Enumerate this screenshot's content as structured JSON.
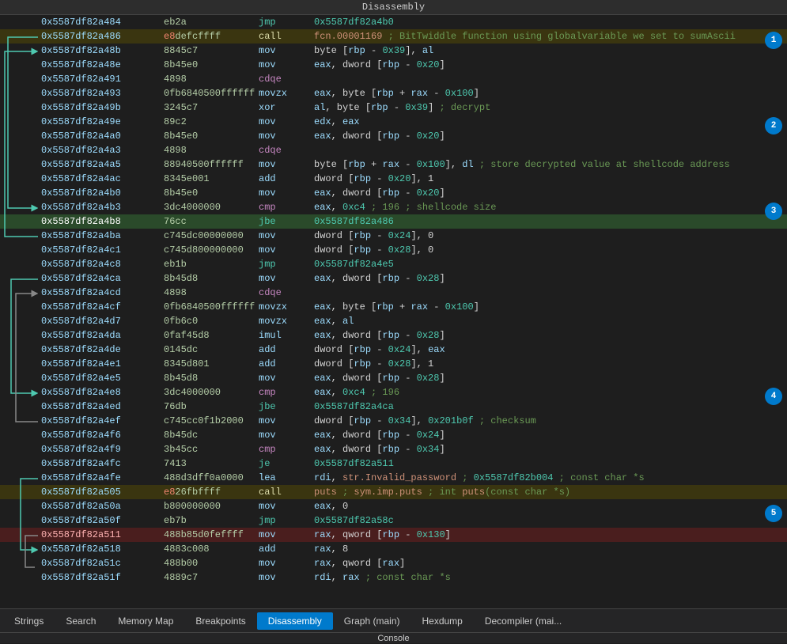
{
  "header": {
    "title": "Disassembly"
  },
  "badges": [
    "1",
    "2",
    "3",
    "4",
    "5"
  ],
  "rows": [
    {
      "addr": "0x5587df82a484",
      "bytes": "eb2a",
      "mnem": "jmp",
      "mnem_class": "jmp",
      "operands": "0x5587df82a4b0",
      "highlight": ""
    },
    {
      "addr": "0x5587df82a486",
      "bytes": "e8defcffff",
      "mnem": "call",
      "mnem_class": "call",
      "operands": "fcn.00001169 ; BitTwiddle function using globalvariable we set to sumAscii",
      "highlight": "call-bg"
    },
    {
      "addr": "0x5587df82a48b",
      "bytes": "8845c7",
      "mnem": "mov",
      "mnem_class": "mov",
      "operands": "byte [rbp - 0x39], al",
      "highlight": ""
    },
    {
      "addr": "0x5587df82a48e",
      "bytes": "8b45e0",
      "mnem": "mov",
      "mnem_class": "mov",
      "operands": "eax, dword [rbp - 0x20]",
      "highlight": ""
    },
    {
      "addr": "0x5587df82a491",
      "bytes": "4898",
      "mnem": "cdqe",
      "mnem_class": "cdqe",
      "operands": "",
      "highlight": ""
    },
    {
      "addr": "0x5587df82a493",
      "bytes": "0fb6840500ffffff",
      "mnem": "movzx",
      "mnem_class": "movzx",
      "operands": "eax, byte [rbp + rax - 0x100]",
      "highlight": ""
    },
    {
      "addr": "0x5587df82a49b",
      "bytes": "3245c7",
      "mnem": "xor",
      "mnem_class": "xor",
      "operands": "al, byte [rbp - 0x39] ; decrypt",
      "highlight": ""
    },
    {
      "addr": "0x5587df82a49e",
      "bytes": "89c2",
      "mnem": "mov",
      "mnem_class": "mov",
      "operands": "edx, eax",
      "highlight": ""
    },
    {
      "addr": "0x5587df82a4a0",
      "bytes": "8b45e0",
      "mnem": "mov",
      "mnem_class": "mov",
      "operands": "eax, dword [rbp - 0x20]",
      "highlight": ""
    },
    {
      "addr": "0x5587df82a4a3",
      "bytes": "4898",
      "mnem": "cdqe",
      "mnem_class": "cdqe",
      "operands": "",
      "highlight": ""
    },
    {
      "addr": "0x5587df82a4a5",
      "bytes": "88940500ffffff",
      "mnem": "mov",
      "mnem_class": "mov",
      "operands": "byte [rbp + rax - 0x100], dl ; store decrypted value at shellcode address",
      "highlight": ""
    },
    {
      "addr": "0x5587df82a4ac",
      "bytes": "8345e001",
      "mnem": "add",
      "mnem_class": "add",
      "operands": "dword [rbp - 0x20], 1",
      "highlight": ""
    },
    {
      "addr": "0x5587df82a4b0",
      "bytes": "8b45e0",
      "mnem": "mov",
      "mnem_class": "mov",
      "operands": "eax, dword [rbp - 0x20]",
      "highlight": ""
    },
    {
      "addr": "0x5587df82a4b3",
      "bytes": "3dc4000000",
      "mnem": "cmp",
      "mnem_class": "cmp",
      "operands": "eax, 0xc4 ; 196 ; shellcode size",
      "highlight": ""
    },
    {
      "addr": "0x5587df82a4b8",
      "bytes": "76cc",
      "mnem": "jbe",
      "mnem_class": "jbe",
      "operands": "0x5587df82a486",
      "highlight": "highlight-green"
    },
    {
      "addr": "0x5587df82a4ba",
      "bytes": "c745dc00000000",
      "mnem": "mov",
      "mnem_class": "mov",
      "operands": "dword [rbp - 0x24], 0",
      "highlight": ""
    },
    {
      "addr": "0x5587df82a4c1",
      "bytes": "c745d800000000",
      "mnem": "mov",
      "mnem_class": "mov",
      "operands": "dword [rbp - 0x28], 0",
      "highlight": ""
    },
    {
      "addr": "0x5587df82a4c8",
      "bytes": "eb1b",
      "mnem": "jmp",
      "mnem_class": "jmp",
      "operands": "0x5587df82a4e5",
      "highlight": ""
    },
    {
      "addr": "0x5587df82a4ca",
      "bytes": "8b45d8",
      "mnem": "mov",
      "mnem_class": "mov",
      "operands": "eax, dword [rbp - 0x28]",
      "highlight": ""
    },
    {
      "addr": "0x5587df82a4cd",
      "bytes": "4898",
      "mnem": "cdqe",
      "mnem_class": "cdqe",
      "operands": "",
      "highlight": ""
    },
    {
      "addr": "0x5587df82a4cf",
      "bytes": "0fb6840500ffffff",
      "mnem": "movzx",
      "mnem_class": "movzx",
      "operands": "eax, byte [rbp + rax - 0x100]",
      "highlight": ""
    },
    {
      "addr": "0x5587df82a4d7",
      "bytes": "0fb6c0",
      "mnem": "movzx",
      "mnem_class": "movzx",
      "operands": "eax, al",
      "highlight": ""
    },
    {
      "addr": "0x5587df82a4da",
      "bytes": "0faf45d8",
      "mnem": "imul",
      "mnem_class": "imul",
      "operands": "eax, dword [rbp - 0x28]",
      "highlight": ""
    },
    {
      "addr": "0x5587df82a4de",
      "bytes": "0145dc",
      "mnem": "add",
      "mnem_class": "add",
      "operands": "dword [rbp - 0x24], eax",
      "highlight": ""
    },
    {
      "addr": "0x5587df82a4e1",
      "bytes": "8345d801",
      "mnem": "add",
      "mnem_class": "add",
      "operands": "dword [rbp - 0x28], 1",
      "highlight": ""
    },
    {
      "addr": "0x5587df82a4e5",
      "bytes": "8b45d8",
      "mnem": "mov",
      "mnem_class": "mov",
      "operands": "eax, dword [rbp - 0x28]",
      "highlight": ""
    },
    {
      "addr": "0x5587df82a4e8",
      "bytes": "3dc4000000",
      "mnem": "cmp",
      "mnem_class": "cmp",
      "operands": "eax, 0xc4 ; 196",
      "highlight": ""
    },
    {
      "addr": "0x5587df82a4ed",
      "bytes": "76db",
      "mnem": "jbe",
      "mnem_class": "jbe",
      "operands": "0x5587df82a4ca",
      "highlight": ""
    },
    {
      "addr": "0x5587df82a4ef",
      "bytes": "c745cc0f1b2000",
      "mnem": "mov",
      "mnem_class": "mov",
      "operands": "dword [rbp - 0x34], 0x201b0f ; checksum",
      "highlight": ""
    },
    {
      "addr": "0x5587df82a4f6",
      "bytes": "8b45dc",
      "mnem": "mov",
      "mnem_class": "mov",
      "operands": "eax, dword [rbp - 0x24]",
      "highlight": ""
    },
    {
      "addr": "0x5587df82a4f9",
      "bytes": "3b45cc",
      "mnem": "cmp",
      "mnem_class": "cmp",
      "operands": "eax, dword [rbp - 0x34]",
      "highlight": ""
    },
    {
      "addr": "0x5587df82a4fc",
      "bytes": "7413",
      "mnem": "je",
      "mnem_class": "je",
      "operands": "0x5587df82a511",
      "highlight": ""
    },
    {
      "addr": "0x5587df82a4fe",
      "bytes": "488d3dff0a0000",
      "mnem": "lea",
      "mnem_class": "lea",
      "operands": "rdi, str.Invalid_password ; 0x5587df82b004 ; const char *s",
      "highlight": ""
    },
    {
      "addr": "0x5587df82a505",
      "bytes": "e826fbffff",
      "mnem": "call",
      "mnem_class": "call",
      "operands": "puts ; sym.imp.puts ; int puts(const char *s)",
      "highlight": "call-bg"
    },
    {
      "addr": "0x5587df82a50a",
      "bytes": "b800000000",
      "mnem": "mov",
      "mnem_class": "mov",
      "operands": "eax, 0",
      "highlight": ""
    },
    {
      "addr": "0x5587df82a50f",
      "bytes": "eb7b",
      "mnem": "jmp",
      "mnem_class": "jmp",
      "operands": "0x5587df82a58c",
      "highlight": ""
    },
    {
      "addr": "0x5587df82a511",
      "bytes": "488b85d0feffff",
      "mnem": "mov",
      "mnem_class": "mov",
      "operands": "rax, qword [rbp - 0x130]",
      "highlight": "highlight-red"
    },
    {
      "addr": "0x5587df82a518",
      "bytes": "4883c008",
      "mnem": "add",
      "mnem_class": "add",
      "operands": "rax, 8",
      "highlight": ""
    },
    {
      "addr": "0x5587df82a51c",
      "bytes": "488b00",
      "mnem": "mov",
      "mnem_class": "mov",
      "operands": "rax, qword [rax]",
      "highlight": ""
    },
    {
      "addr": "0x5587df82a51f",
      "bytes": "4889c7",
      "mnem": "mov",
      "mnem_class": "mov",
      "operands": "rdi, rax ; const char *s",
      "highlight": ""
    }
  ],
  "tabs": [
    {
      "label": "Strings",
      "active": false
    },
    {
      "label": "Search",
      "active": false
    },
    {
      "label": "Memory Map",
      "active": false
    },
    {
      "label": "Breakpoints",
      "active": false
    },
    {
      "label": "Disassembly",
      "active": true
    },
    {
      "label": "Graph (main)",
      "active": false
    },
    {
      "label": "Hexdump",
      "active": false
    },
    {
      "label": "Decompiler (mai...",
      "active": false
    }
  ],
  "bottom_bar": {
    "label": "Console"
  }
}
